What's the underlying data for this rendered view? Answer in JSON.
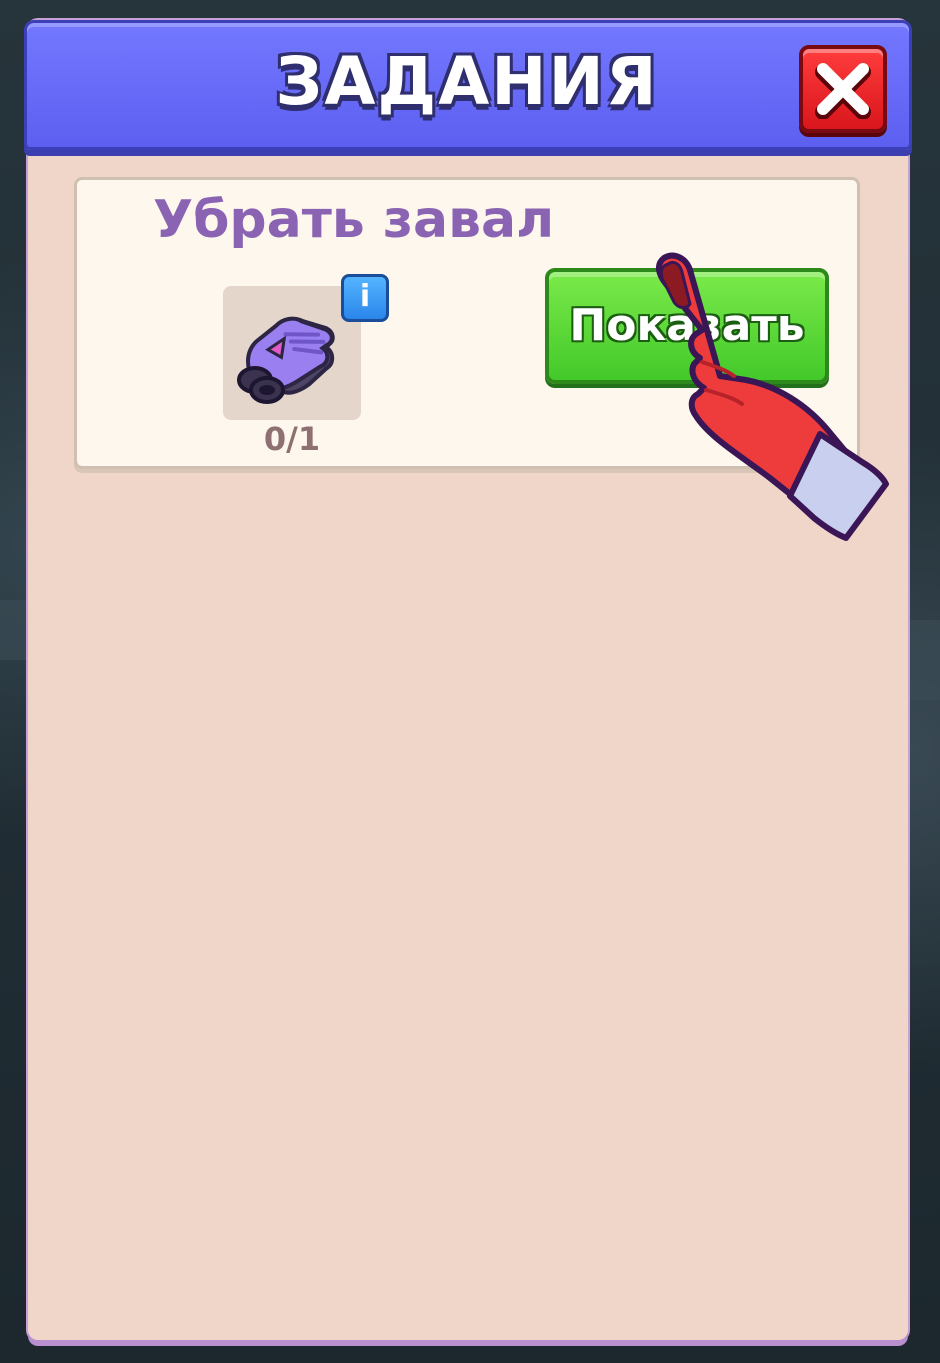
{
  "header": {
    "title": "ЗАДАНИЯ",
    "close_icon": "close-x-icon"
  },
  "quests": [
    {
      "title": "Убрать завал",
      "item": {
        "icon": "gloves-icon",
        "count": "0/1",
        "info_label": "i"
      },
      "action_label": "Показать"
    }
  ],
  "tutorial": {
    "icon": "pointing-hand-icon"
  },
  "colors": {
    "header": "#6467f7",
    "panel": "#efd6c9",
    "card": "#fdf7ee",
    "title_text": "#8a64b2",
    "action_button": "#52d334",
    "close_button": "#e8242a",
    "info_badge": "#3a98f2"
  }
}
